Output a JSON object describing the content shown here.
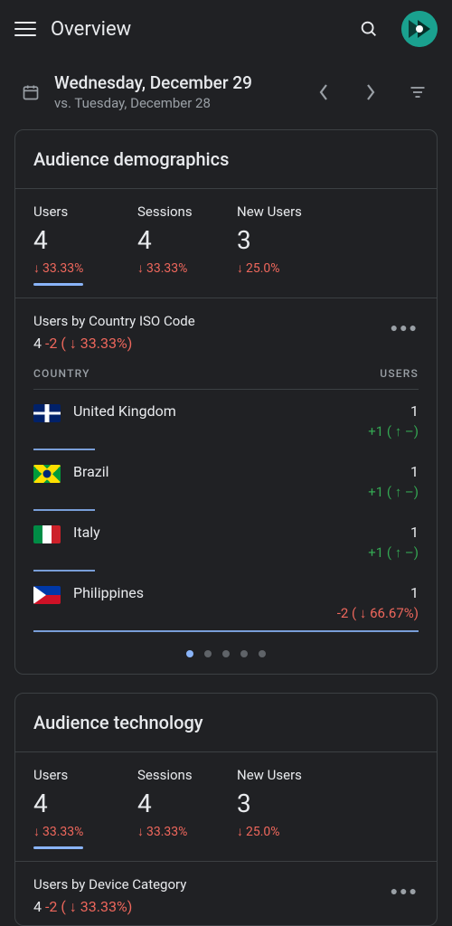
{
  "header": {
    "title": "Overview"
  },
  "date": {
    "main": "Wednesday, December 29",
    "compare": "vs. Tuesday, December 28"
  },
  "cards": {
    "demographics": {
      "title": "Audience demographics",
      "metrics": [
        {
          "label": "Users",
          "value": "4",
          "delta": "33.33%"
        },
        {
          "label": "Sessions",
          "value": "4",
          "delta": "33.33%"
        },
        {
          "label": "New Users",
          "value": "3",
          "delta": "25.0%"
        }
      ],
      "subhead": {
        "title": "Users by Country ISO Code",
        "value": "4",
        "delta_abs": "-2",
        "delta_pct": "33.33%"
      },
      "table": {
        "col_country": "COUNTRY",
        "col_users": "USERS",
        "rows": [
          {
            "country": "United Kingdom",
            "value": "1",
            "delta": "+1 ( ↑ –)",
            "dir": "pos",
            "flag": "uk"
          },
          {
            "country": "Brazil",
            "value": "1",
            "delta": "+1 ( ↑ –)",
            "dir": "pos",
            "flag": "br"
          },
          {
            "country": "Italy",
            "value": "1",
            "delta": "+1 ( ↑ –)",
            "dir": "pos",
            "flag": "it"
          },
          {
            "country": "Philippines",
            "value": "1",
            "delta": "-2 ( ↓ 66.67%)",
            "dir": "neg",
            "flag": "ph"
          }
        ]
      }
    },
    "technology": {
      "title": "Audience technology",
      "metrics": [
        {
          "label": "Users",
          "value": "4",
          "delta": "33.33%"
        },
        {
          "label": "Sessions",
          "value": "4",
          "delta": "33.33%"
        },
        {
          "label": "New Users",
          "value": "3",
          "delta": "25.0%"
        }
      ],
      "subhead": {
        "title": "Users by Device Category",
        "value": "4",
        "delta_abs": "-2",
        "delta_pct": "33.33%"
      }
    }
  }
}
